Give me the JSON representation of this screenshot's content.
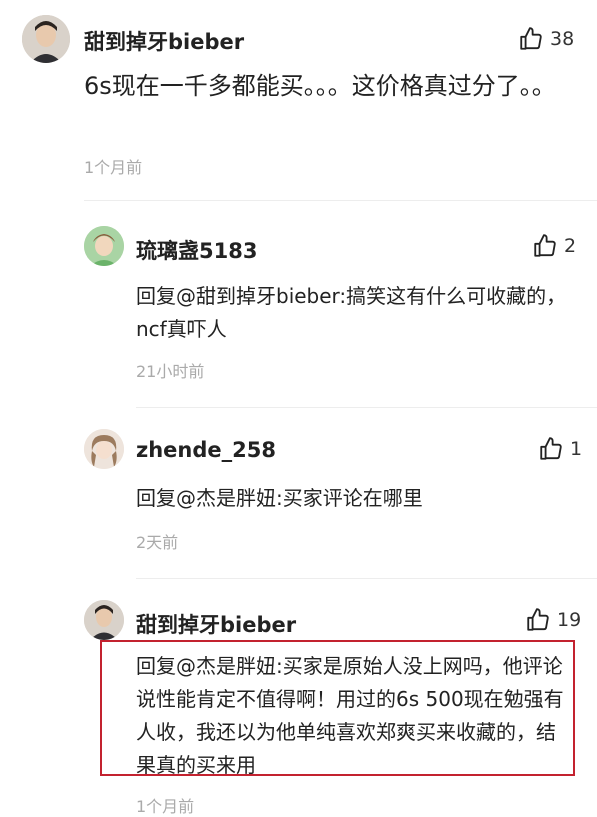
{
  "comment": {
    "username": "甜到掉牙bieber",
    "likes": "38",
    "text": "6s现在一千多都能买。。。这价格真过分了。。",
    "time": "1个月前"
  },
  "replies": [
    {
      "username": "琉璃盏5183",
      "likes": "2",
      "text": "回复@甜到掉牙bieber:搞笑这有什么可收藏的，ncf真吓人",
      "time": "21小时前"
    },
    {
      "username": "zhende_258",
      "likes": "1",
      "text": "回复@杰是胖妞:买家评论在哪里",
      "time": "2天前"
    },
    {
      "username": "甜到掉牙bieber",
      "likes": "19",
      "text": "回复@杰是胖妞:买家是原始人没上网吗，他评论说性能肯定不值得啊！用过的6s 500现在勉强有人收，我还以为他单纯喜欢郑爽买来收藏的，结果真的买来用",
      "time": "1个月前"
    }
  ],
  "colors": {
    "highlight": "#c3222f",
    "muted": "#aaaaaa"
  },
  "icons": {
    "like": "thumbs-up-icon"
  }
}
